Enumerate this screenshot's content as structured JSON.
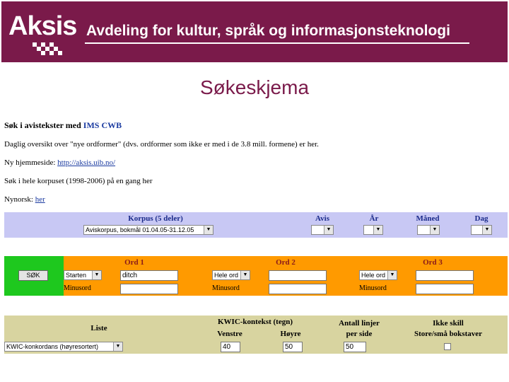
{
  "banner": {
    "logo": "Aksis",
    "title": "Avdeling for kultur, språk og informasjonsteknologi"
  },
  "page_title": "Søkeskjema",
  "intro": {
    "heading_prefix": "Søk i avistekster med",
    "heading_link": "IMS CWB",
    "line1": "Daglig oversikt over \"nye ordformer\" (dvs. ordformer som ikke er med i de 3.8 mill. formene) er her.",
    "line2_prefix": "Ny hjemmeside:",
    "line2_link": "http://aksis.uib.no/",
    "line3": "Søk i hele korpuset (1998-2006) på en gang her",
    "line4_prefix": "Nynorsk:",
    "line4_link": "her"
  },
  "corpus_row": {
    "headers": {
      "corpus": "Korpus (5 deler)",
      "avis": "Avis",
      "ar": "År",
      "maned": "Måned",
      "dag": "Dag"
    },
    "corpus_select": "Aviskorpus, bokmål 01.04.05-31.12.05",
    "avis_select": "",
    "ar_select": "",
    "maned_select": "",
    "dag_select": ""
  },
  "words_row": {
    "search_button": "SØK",
    "ord1": {
      "header": "Ord 1",
      "mode": "Starten",
      "value": "ditch",
      "minus_label": "Minusord",
      "minus_value": ""
    },
    "ord2": {
      "header": "Ord 2",
      "mode": "Hele ord",
      "value": "",
      "minus_label": "Minusord",
      "minus_value": ""
    },
    "ord3": {
      "header": "Ord 3",
      "mode": "Hele ord",
      "value": "",
      "minus_label": "Minusord",
      "minus_value": ""
    }
  },
  "list_row": {
    "liste_header": "Liste",
    "liste_select": "KWIC-konkordans (høyresortert)",
    "kwic_header": "KWIC-kontekst (tegn)",
    "venstre_label": "Venstre",
    "hoyre_label": "Høyre",
    "venstre_value": "40",
    "hoyre_value": "50",
    "lines_header_1": "Antall linjer",
    "lines_header_2": "per side",
    "lines_value": "50",
    "case_header_1": "Ikke skill",
    "case_header_2": "Store/små bokstaver",
    "case_checked": false
  },
  "colors": {
    "brand": "#7a1a4a",
    "corpus_band": "#c8c8f4",
    "words_band": "#ff9a00",
    "search_green": "#1ec81e",
    "list_band": "#d8d4a0"
  }
}
